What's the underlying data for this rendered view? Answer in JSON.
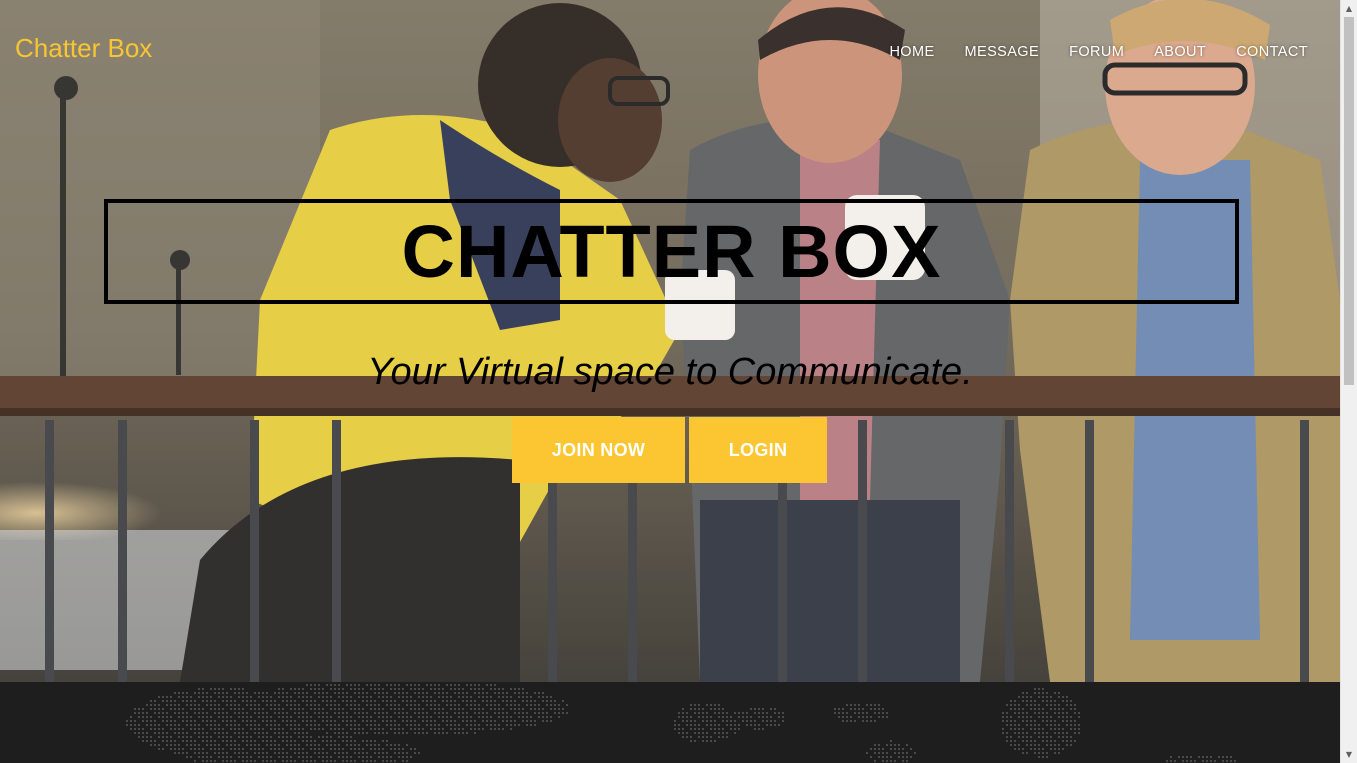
{
  "brand": {
    "name": "Chatter Box",
    "color": "#f7c631"
  },
  "nav": {
    "items": [
      "HOME",
      "MESSAGE",
      "FORUM",
      "ABOUT",
      "CONTACT"
    ]
  },
  "hero": {
    "title": "CHATTER BOX",
    "tagline": "Your Virtual space to Communicate.",
    "join_label": "JOIN NOW",
    "login_label": "LOGIN",
    "button_color": "#fbc631"
  },
  "footer": {
    "background_color": "#1e1e1e",
    "map_graphic": "dotted-world-map"
  },
  "icons": {
    "scroll_up": "scroll-up-arrow-icon",
    "scroll_down": "scroll-down-arrow-icon"
  }
}
